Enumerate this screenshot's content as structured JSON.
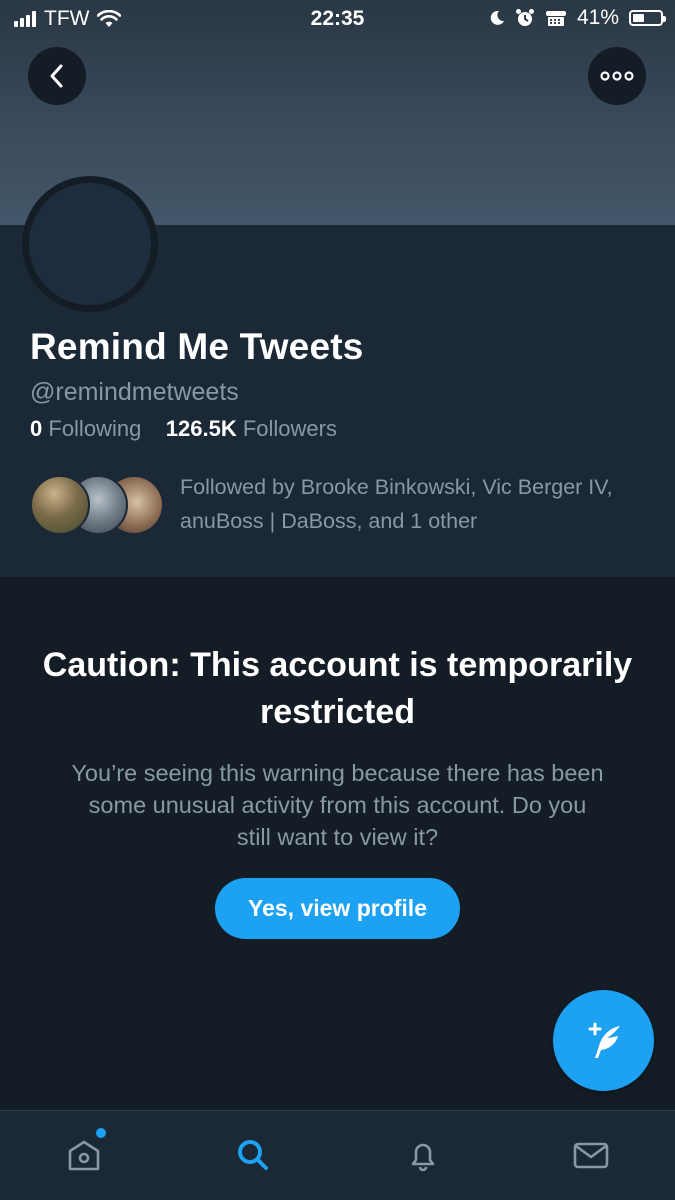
{
  "status_bar": {
    "carrier": "TFW",
    "time": "22:35",
    "battery": "41%",
    "battery_level": 0.41
  },
  "profile": {
    "name": "Remind Me Tweets",
    "handle": "@remindmetweets",
    "following_count": "0",
    "following_label": "Following",
    "followers_count": "126.5K",
    "followers_label": "Followers",
    "followed_by": "Followed by Brooke Binkowski, Vic Berger IV, anuBoss | DaBoss, and 1 other"
  },
  "warning": {
    "title": "Caution: This account is temporarily restricted",
    "message": "You’re seeing this warning because there has been some unusual activity from this account. Do you still want to view it?",
    "button_label": "Yes, view profile"
  },
  "tab_bar": {
    "items": [
      "home-icon",
      "search-icon",
      "notifications-icon",
      "messages-icon"
    ],
    "active": "search-icon"
  },
  "colors": {
    "accent": "#1da1f2",
    "background": "#141d26",
    "secondary_text": "#8899a6"
  }
}
